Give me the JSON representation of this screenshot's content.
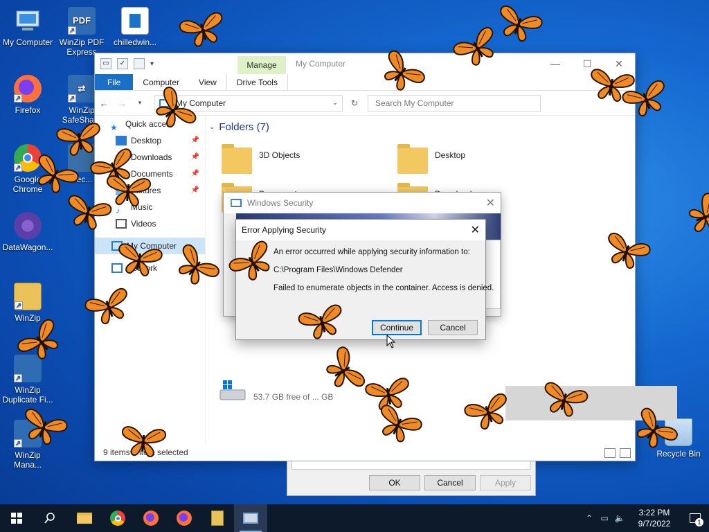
{
  "desktop": {
    "icons": [
      {
        "label": "My Computer"
      },
      {
        "label": "WinZip PDF Express"
      },
      {
        "label": "chilledwin..."
      },
      {
        "label": "Firefox"
      },
      {
        "label": "WinZip SafeShare"
      },
      {
        "label": "Google Chrome"
      },
      {
        "label": "Sec..."
      },
      {
        "label": "DataWagon..."
      },
      {
        "label": "WinZip"
      },
      {
        "label": "WinZip Duplicate Fi..."
      },
      {
        "label": "WinZip Mana..."
      },
      {
        "label": "Recycle Bin"
      }
    ]
  },
  "explorer": {
    "title": "My Computer",
    "manage_tab": "Manage",
    "ribbon_tabs": [
      "File",
      "Computer",
      "View",
      "Drive Tools"
    ],
    "address": "My Computer",
    "search_placeholder": "Search My Computer",
    "nav": [
      {
        "label": "Quick acce..."
      },
      {
        "label": "Desktop"
      },
      {
        "label": "Downloads"
      },
      {
        "label": "Documents"
      },
      {
        "label": "Pictures"
      },
      {
        "label": "Music"
      },
      {
        "label": "Videos"
      },
      {
        "label": "My Computer"
      },
      {
        "label": "Network"
      }
    ],
    "group_header": "Folders (7)",
    "folders": [
      {
        "label": "3D Objects"
      },
      {
        "label": "Desktop"
      },
      {
        "label": "Documents"
      },
      {
        "label": "Downloads"
      }
    ],
    "drive_free": "53.7 GB free of ... GB",
    "status": "9 items   1 item selected"
  },
  "properties_dialog": {
    "ok": "OK",
    "cancel": "Cancel",
    "apply": "Apply"
  },
  "windows_security": {
    "title": "Windows Security"
  },
  "error_dialog": {
    "title": "Error Applying Security",
    "line1": "An error occurred while applying security information to:",
    "line2": "C:\\Program Files\\Windows Defender",
    "line3": "Failed to enumerate objects in the container. Access is denied.",
    "continue": "Continue",
    "cancel": "Cancel"
  },
  "taskbar": {
    "time": "3:22 PM",
    "date": "9/7/2022",
    "notification_count": "1"
  },
  "colors": {
    "accent": "#0078d7",
    "file_tab": "#1a6fc9",
    "manage_tab": "#dff1c6",
    "butterfly": "#f08a24"
  }
}
